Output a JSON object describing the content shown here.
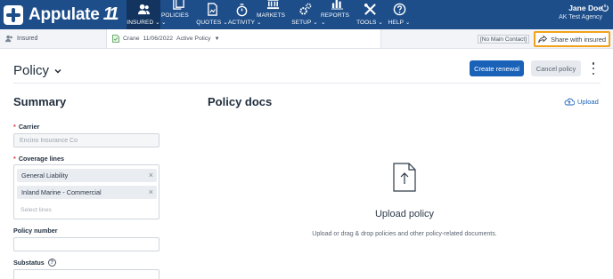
{
  "app": {
    "brand": "Appulate",
    "brand_tail": "11"
  },
  "nav": {
    "items": [
      {
        "key": "insured",
        "label": "INSURED",
        "icon": "people-icon",
        "active": true
      },
      {
        "key": "policies",
        "label": "POLICIES",
        "icon": "documents-icon"
      },
      {
        "key": "quotes",
        "label": "QUOTES",
        "icon": "quote-docs-icon"
      },
      {
        "key": "activity",
        "label": "ACTIVITY",
        "icon": "stopwatch-icon"
      },
      {
        "key": "markets",
        "label": "MARKETS",
        "icon": "bank-icon"
      },
      {
        "key": "setup",
        "label": "SETUP",
        "icon": "gears-icon"
      },
      {
        "key": "reports",
        "label": "REPORTS",
        "icon": "bar-chart-icon"
      },
      {
        "key": "tools",
        "label": "TOOLS",
        "icon": "wrench-screwdriver-icon"
      },
      {
        "key": "help",
        "label": "HELP",
        "icon": "question-icon"
      }
    ],
    "caret": "⌄"
  },
  "user": {
    "name": "Jane Doe",
    "agency": "AK Test Agency",
    "icon": "power-icon"
  },
  "context": {
    "insured_tab": "Insured",
    "policy_name": "Crane",
    "policy_date": "11/06/2022",
    "policy_status": "Active Policy",
    "contact": "[No Main Contact]",
    "share_label": "Share with insured"
  },
  "header": {
    "title": "Policy",
    "create_renewal": "Create renewal",
    "cancel_policy": "Cancel policy"
  },
  "summary": {
    "title": "Summary",
    "carrier_label": "Carrier",
    "carrier_value": "Encino Insurance Co",
    "coverage_label": "Coverage lines",
    "coverage_lines": [
      "General Liability",
      "Inland Marine - Commercial"
    ],
    "coverage_placeholder": "Select lines",
    "policy_number_label": "Policy number",
    "policy_number_value": "",
    "substatus_label": "Substatus"
  },
  "docs": {
    "title": "Policy docs",
    "upload_link": "Upload",
    "heading": "Upload policy",
    "subtext": "Upload or drag & drop policies and other policy-related documents."
  },
  "colors": {
    "nav_bg": "#1d4e8a",
    "nav_active": "#12345e",
    "primary": "#1a62b8",
    "highlight": "#f1a21a",
    "required": "#d33b3b"
  }
}
